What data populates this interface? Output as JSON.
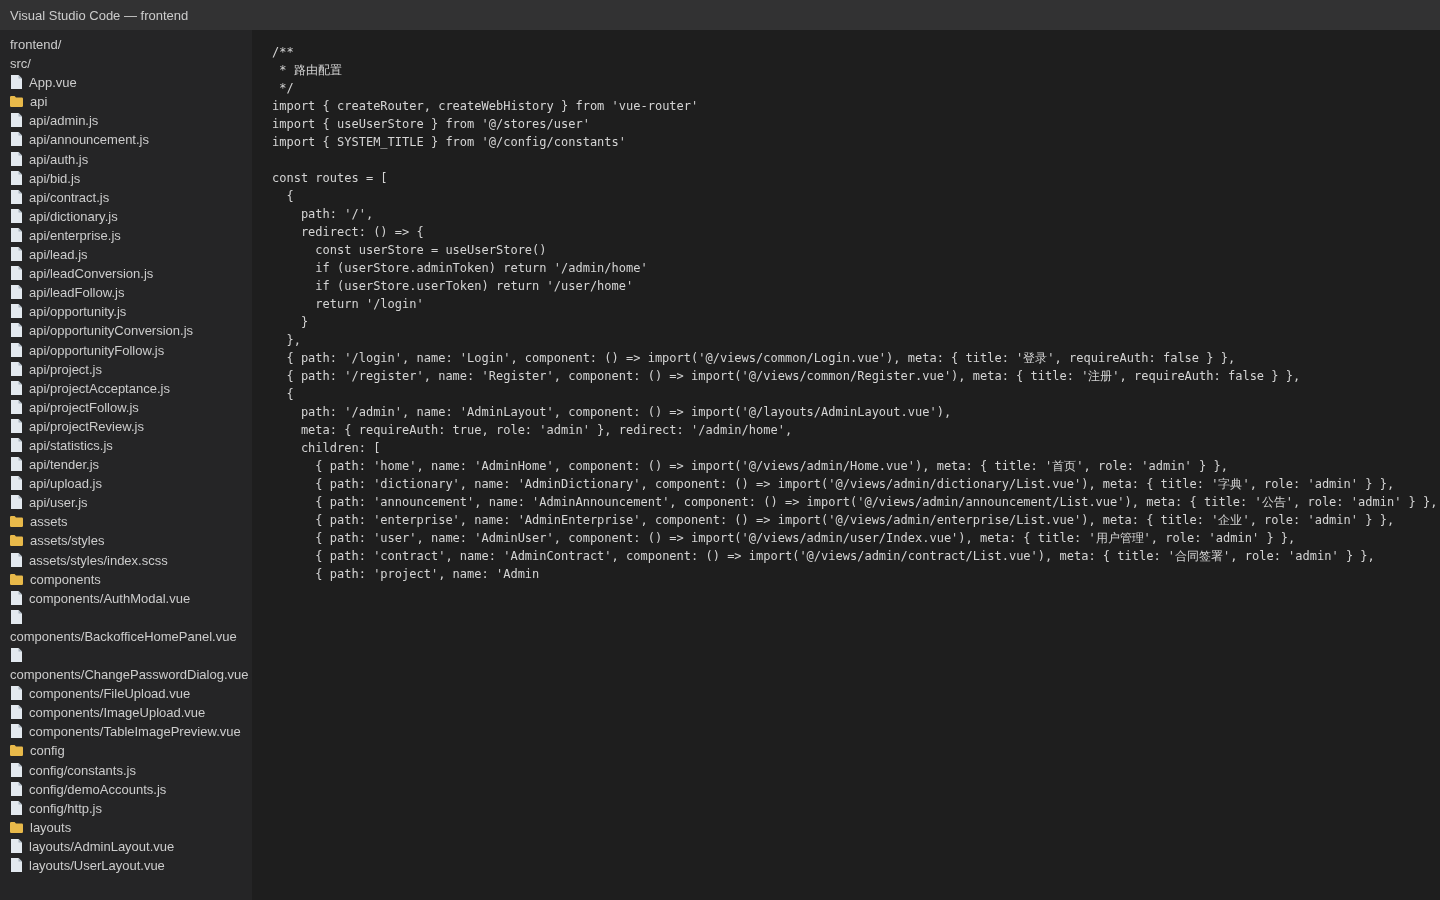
{
  "window": {
    "title": "Visual Studio Code — frontend"
  },
  "sidebar": {
    "items": [
      {
        "kind": "heading",
        "label": "frontend/"
      },
      {
        "kind": "heading",
        "label": "src/"
      },
      {
        "kind": "file",
        "label": "App.vue"
      },
      {
        "kind": "folder",
        "label": "api"
      },
      {
        "kind": "file",
        "label": "api/admin.js"
      },
      {
        "kind": "file",
        "label": "api/announcement.js"
      },
      {
        "kind": "file",
        "label": "api/auth.js"
      },
      {
        "kind": "file",
        "label": "api/bid.js"
      },
      {
        "kind": "file",
        "label": "api/contract.js"
      },
      {
        "kind": "file",
        "label": "api/dictionary.js"
      },
      {
        "kind": "file",
        "label": "api/enterprise.js"
      },
      {
        "kind": "file",
        "label": "api/lead.js"
      },
      {
        "kind": "file",
        "label": "api/leadConversion.js"
      },
      {
        "kind": "file",
        "label": "api/leadFollow.js"
      },
      {
        "kind": "file",
        "label": "api/opportunity.js"
      },
      {
        "kind": "file",
        "label": "api/opportunityConversion.js"
      },
      {
        "kind": "file",
        "label": "api/opportunityFollow.js"
      },
      {
        "kind": "file",
        "label": "api/project.js"
      },
      {
        "kind": "file",
        "label": "api/projectAcceptance.js"
      },
      {
        "kind": "file",
        "label": "api/projectFollow.js"
      },
      {
        "kind": "file",
        "label": "api/projectReview.js"
      },
      {
        "kind": "file",
        "label": "api/statistics.js"
      },
      {
        "kind": "file",
        "label": "api/tender.js"
      },
      {
        "kind": "file",
        "label": "api/upload.js"
      },
      {
        "kind": "file",
        "label": "api/user.js"
      },
      {
        "kind": "folder",
        "label": "assets"
      },
      {
        "kind": "folder",
        "label": "assets/styles"
      },
      {
        "kind": "file",
        "label": "assets/styles/index.scss"
      },
      {
        "kind": "folder",
        "label": "components"
      },
      {
        "kind": "file",
        "label": "components/AuthModal.vue"
      },
      {
        "kind": "file",
        "label": "components/BackofficeHomePanel.vue"
      },
      {
        "kind": "file",
        "label": "components/ChangePasswordDialog.vue"
      },
      {
        "kind": "file",
        "label": "components/FileUpload.vue"
      },
      {
        "kind": "file",
        "label": "components/ImageUpload.vue"
      },
      {
        "kind": "file",
        "label": "components/TableImagePreview.vue"
      },
      {
        "kind": "folder",
        "label": "config"
      },
      {
        "kind": "file",
        "label": "config/constants.js"
      },
      {
        "kind": "file",
        "label": "config/demoAccounts.js"
      },
      {
        "kind": "file",
        "label": "config/http.js"
      },
      {
        "kind": "folder",
        "label": "layouts"
      },
      {
        "kind": "file",
        "label": "layouts/AdminLayout.vue"
      },
      {
        "kind": "file",
        "label": "layouts/UserLayout.vue"
      }
    ]
  },
  "editor": {
    "blocks": [
      [
        "/**",
        " * 路由配置",
        " */",
        "import { createRouter, createWebHistory } from 'vue-router'",
        "import { useUserStore } from '@/stores/user'",
        "import { SYSTEM_TITLE } from '@/config/constants'"
      ],
      [
        "const routes = [",
        "  {",
        "    path: '/',",
        "    redirect: () => {",
        "      const userStore = useUserStore()",
        "      if (userStore.adminToken) return '/admin/home'",
        "      if (userStore.userToken) return '/user/home'",
        "      return '/login'",
        "    }",
        "  },",
        "  { path: '/login', name: 'Login', component: () => import('@/views/common/Login.vue'), meta: { title: '登录', requireAuth: false } },",
        "  { path: '/register', name: 'Register', component: () => import('@/views/common/Register.vue'), meta: { title: '注册', requireAuth: false } },",
        "  {",
        "    path: '/admin', name: 'AdminLayout', component: () => import('@/layouts/AdminLayout.vue'),",
        "    meta: { requireAuth: true, role: 'admin' }, redirect: '/admin/home',",
        "    children: [",
        "      { path: 'home', name: 'AdminHome', component: () => import('@/views/admin/Home.vue'), meta: { title: '首页', role: 'admin' } },",
        "      { path: 'dictionary', name: 'AdminDictionary', component: () => import('@/views/admin/dictionary/List.vue'), meta: { title: '字典', role: 'admin' } },",
        "      { path: 'announcement', name: 'AdminAnnouncement', component: () => import('@/views/admin/announcement/List.vue'), meta: { title: '公告', role: 'admin' } },",
        "      { path: 'enterprise', name: 'AdminEnterprise', component: () => import('@/views/admin/enterprise/List.vue'), meta: { title: '企业', role: 'admin' } },",
        "      { path: 'user', name: 'AdminUser', component: () => import('@/views/admin/user/Index.vue'), meta: { title: '用户管理', role: 'admin' } },",
        "      { path: 'contract', name: 'AdminContract', component: () => import('@/views/admin/contract/List.vue'), meta: { title: '合同签署', role: 'admin' } },",
        "      { path: 'project', name: 'Admin"
      ]
    ]
  }
}
